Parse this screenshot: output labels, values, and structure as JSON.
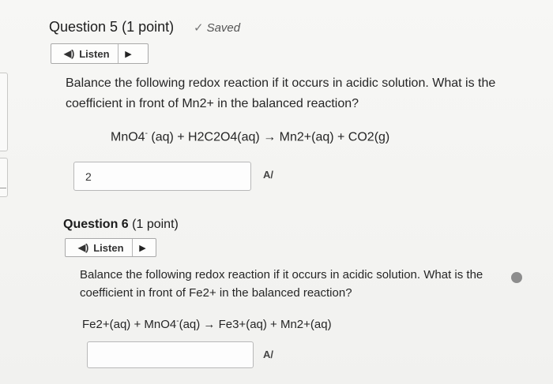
{
  "question5": {
    "title": "Question 5",
    "points": "(1 point)",
    "saved": "Saved",
    "listen": "Listen",
    "prompt": "Balance the following redox reaction if it occurs in acidic solution.  What is the coefficient in front of Mn2+ in the balanced reaction?",
    "equation": "MnO4- (aq) + H2C2O4(aq) → Mn2+(aq) + CO2(g)",
    "answer_value": "2"
  },
  "question6": {
    "title": "Question 6",
    "points": "(1 point)",
    "listen": "Listen",
    "prompt": "Balance the following redox reaction if it occurs in acidic solution.  What is the coefficient in front of Fe2+ in the balanced reaction?",
    "equation": "Fe2+(aq) + MnO4-(aq) → Fe3+(aq) + Mn2+(aq)",
    "answer_value": ""
  },
  "icons": {
    "saved": "checkmark-icon",
    "listen": "speaker-icon",
    "play": "play-icon",
    "spellcheck": "spellcheck-icon"
  }
}
